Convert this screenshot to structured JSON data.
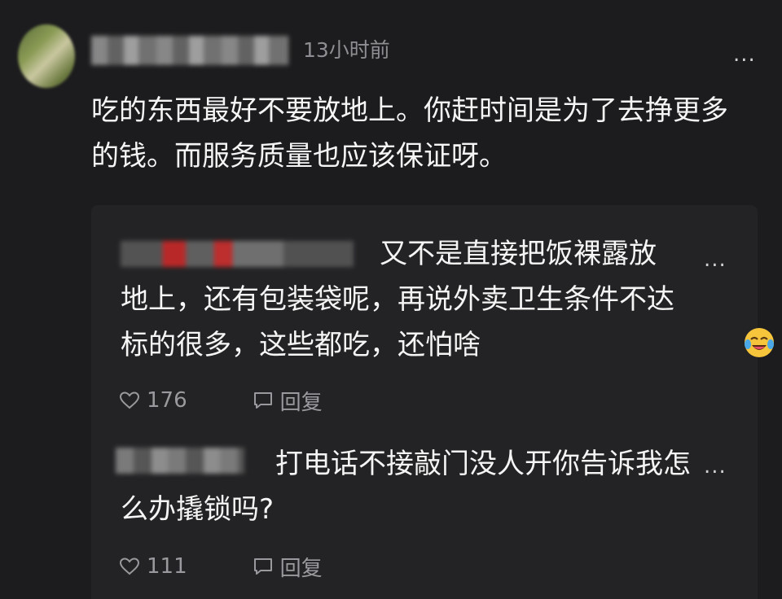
{
  "comment": {
    "timestamp": "13小时前",
    "text": "吃的东西最好不要放地上。你赶时间是为了去挣更多的钱。而服务质量也应该保证呀。",
    "more_label": "..."
  },
  "replies": [
    {
      "text": "又不是直接把饭裸露放地上，还有包装袋呢，再说外卖卫生条件不达标的很多，这些都吃，还怕啥",
      "emoji": "crying-laughing-emoji",
      "likes": "176",
      "reply_label": "回复",
      "more_label": "..."
    },
    {
      "text": "打电话不接敲门没人开你告诉我怎么办撬锁吗?",
      "likes": "111",
      "reply_label": "回复",
      "more_label": "..."
    }
  ],
  "colors": {
    "background": "#1c1c1e",
    "panel": "#232325",
    "text": "#f5f5f5",
    "muted": "#9a9a9e"
  }
}
